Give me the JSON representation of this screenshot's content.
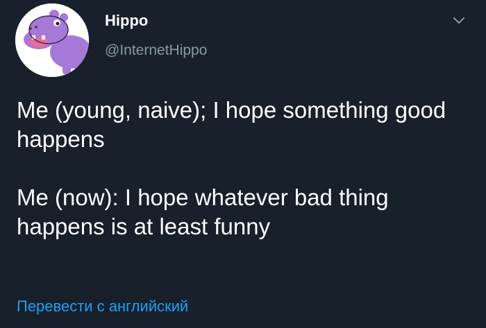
{
  "tweet": {
    "author": {
      "name": "Hippo",
      "handle": "@InternetHippo"
    },
    "body": {
      "line1": "Me (young, naive); I hope something good happens",
      "line2": "Me (now): I hope whatever bad thing happens is at least funny"
    },
    "translate_label": "Перевести с английский"
  },
  "colors": {
    "background": "#17202b",
    "text": "#ffffff",
    "secondary": "#8899a6",
    "link": "#1da1f2",
    "avatar_hippo": "#a679d8"
  },
  "icons": {
    "menu": "chevron-down-icon"
  }
}
